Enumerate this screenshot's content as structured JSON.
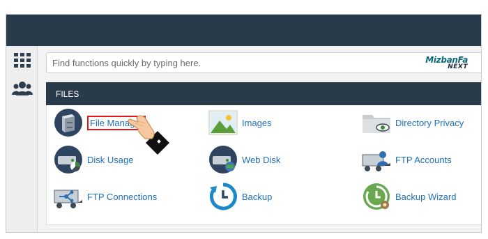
{
  "search": {
    "placeholder": "Find functions quickly by typing here."
  },
  "brand": {
    "logo_line1": "MizbanFa",
    "logo_line2": "NEXT"
  },
  "section": {
    "title": "FILES"
  },
  "items": [
    {
      "label": "File Manager"
    },
    {
      "label": "Images"
    },
    {
      "label": "Directory Privacy"
    },
    {
      "label": "Disk Usage"
    },
    {
      "label": "Web Disk"
    },
    {
      "label": "FTP Accounts"
    },
    {
      "label": "FTP Connections"
    },
    {
      "label": "Backup"
    },
    {
      "label": "Backup Wizard"
    }
  ],
  "colors": {
    "topbar": "#293a4a",
    "link": "#1f6fb6",
    "highlight": "#e5151c"
  },
  "icons": [
    "grid-icon",
    "users-icon"
  ]
}
